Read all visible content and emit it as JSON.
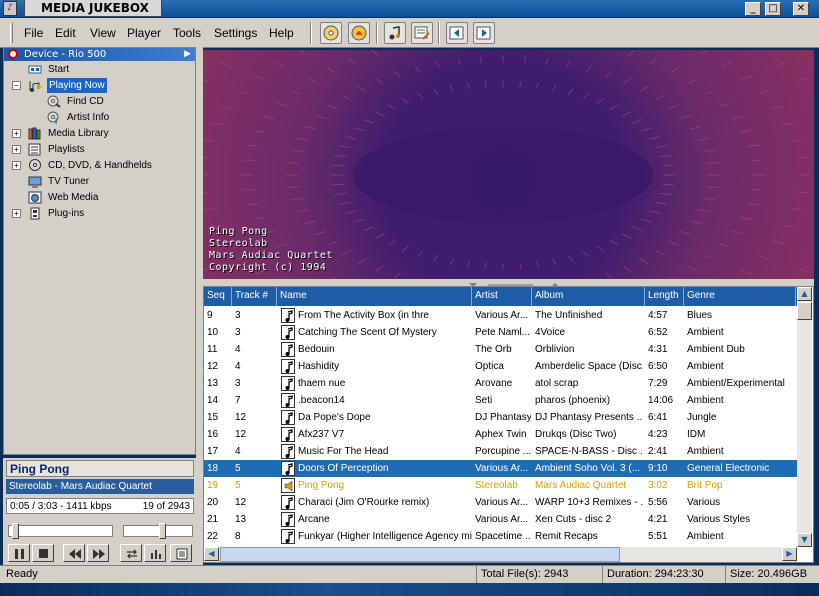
{
  "window": {
    "title": "MEDIA JUKEBOX",
    "min_label": "_",
    "max_label": "□",
    "close_label": "✕"
  },
  "menu": [
    "File",
    "Edit",
    "View",
    "Player",
    "Tools",
    "Settings",
    "Help"
  ],
  "tree": {
    "device": "Device - Rio 500",
    "items": [
      {
        "label": "Start",
        "icon": "start-icon",
        "expander": ""
      },
      {
        "label": "Playing Now",
        "icon": "playing-now-icon",
        "expander": "−",
        "selected": true
      },
      {
        "label": "Find CD",
        "icon": "find-cd-icon",
        "expander": ""
      },
      {
        "label": "Artist Info",
        "icon": "artist-info-icon",
        "expander": ""
      },
      {
        "label": "Media Library",
        "icon": "media-library-icon",
        "expander": "+"
      },
      {
        "label": "Playlists",
        "icon": "playlists-icon",
        "expander": "+"
      },
      {
        "label": "CD, DVD, & Handhelds",
        "icon": "cd-dvd-icon",
        "expander": "+"
      },
      {
        "label": "TV Tuner",
        "icon": "tv-tuner-icon",
        "expander": ""
      },
      {
        "label": "Web Media",
        "icon": "web-media-icon",
        "expander": ""
      },
      {
        "label": "Plug-ins",
        "icon": "plugins-icon",
        "expander": "+"
      }
    ]
  },
  "now_playing": {
    "title": "Ping Pong",
    "artist_album": "Stereolab - Mars Audiac Quartet",
    "time": "0:05 / 3:03 - 1411 kbps",
    "count": "19 of 2943",
    "position_fraction": 0.03,
    "volume_fraction": 0.55
  },
  "visualizer": {
    "lines": [
      "Ping Pong",
      "Stereolab",
      "Mars Audiac Quartet",
      "Copyright (c) 1994"
    ]
  },
  "columns": [
    "Seq",
    "Track #",
    "Name",
    "Artist",
    "Album",
    "Length",
    "Genre"
  ],
  "rows": [
    {
      "seq": "9",
      "track": "3",
      "name": "From The Activity Box (in thre",
      "artist": "Various Ar...",
      "album": "The Unfinished",
      "length": "4:57",
      "genre": "Blues"
    },
    {
      "seq": "10",
      "track": "3",
      "name": "Catching The Scent Of Mystery",
      "artist": "Pete Naml...",
      "album": "4Voice",
      "length": "6:52",
      "genre": "Ambient"
    },
    {
      "seq": "11",
      "track": "4",
      "name": "Bedouin",
      "artist": "The Orb",
      "album": "Orblivion",
      "length": "4:31",
      "genre": "Ambient Dub"
    },
    {
      "seq": "12",
      "track": "4",
      "name": "Hashidity",
      "artist": "Optica",
      "album": "Amberdelic Space (Disc...",
      "length": "6:50",
      "genre": "Ambient"
    },
    {
      "seq": "13",
      "track": "3",
      "name": "thaem nue",
      "artist": "Arovane",
      "album": "atol scrap",
      "length": "7:29",
      "genre": "Ambient/Experimental"
    },
    {
      "seq": "14",
      "track": "7",
      "name": ".beacon14",
      "artist": "Seti",
      "album": "pharos (phoenix)",
      "length": "14:06",
      "genre": "Ambient"
    },
    {
      "seq": "15",
      "track": "12",
      "name": "Da Pope's Dope",
      "artist": "DJ Phantasy",
      "album": "DJ Phantasy Presents ...",
      "length": "6:41",
      "genre": "Jungle"
    },
    {
      "seq": "16",
      "track": "12",
      "name": "Afx237 V7",
      "artist": "Aphex Twin",
      "album": "Drukqs (Disc Two)",
      "length": "4:23",
      "genre": "IDM"
    },
    {
      "seq": "17",
      "track": "4",
      "name": "Music For The Head",
      "artist": "Porcupine ...",
      "album": "SPACE-N-BASS - Disc ...",
      "length": "2:41",
      "genre": "Ambient"
    },
    {
      "seq": "18",
      "track": "5",
      "name": "Doors Of Perception",
      "artist": "Various Ar...",
      "album": "Ambient Soho Vol. 3 (...",
      "length": "9:10",
      "genre": "General Electronic",
      "state": "selected"
    },
    {
      "seq": "19",
      "track": "5",
      "name": "Ping Pong",
      "artist": "Stereolab",
      "album": "Mars Audiac Quartet",
      "length": "3:02",
      "genre": "Brit Pop",
      "state": "playing"
    },
    {
      "seq": "20",
      "track": "12",
      "name": "Characi (Jim O'Rourke remix)",
      "artist": "Various Ar...",
      "album": "WARP 10+3 Remixes - ...",
      "length": "5:56",
      "genre": "Various"
    },
    {
      "seq": "21",
      "track": "13",
      "name": "Arcane",
      "artist": "Various Ar...",
      "album": "Xen Cuts - disc 2",
      "length": "4:21",
      "genre": "Various Styles"
    },
    {
      "seq": "22",
      "track": "8",
      "name": "Funkyar (Higher Intelligence Agency mix)",
      "artist": "Spacetime ...",
      "album": "Remit Recaps",
      "length": "5:51",
      "genre": "Ambient"
    }
  ],
  "status": {
    "state": "Ready",
    "total_files": "Total File(s): 2943",
    "duration": "Duration: 294:23:30",
    "size": "Size: 20.496GB"
  },
  "colors": {
    "header": "#1f5ca8",
    "selected_row": "#1f6cb6",
    "playing_text": "#d4a000",
    "titlebar": "#0d4f96"
  }
}
